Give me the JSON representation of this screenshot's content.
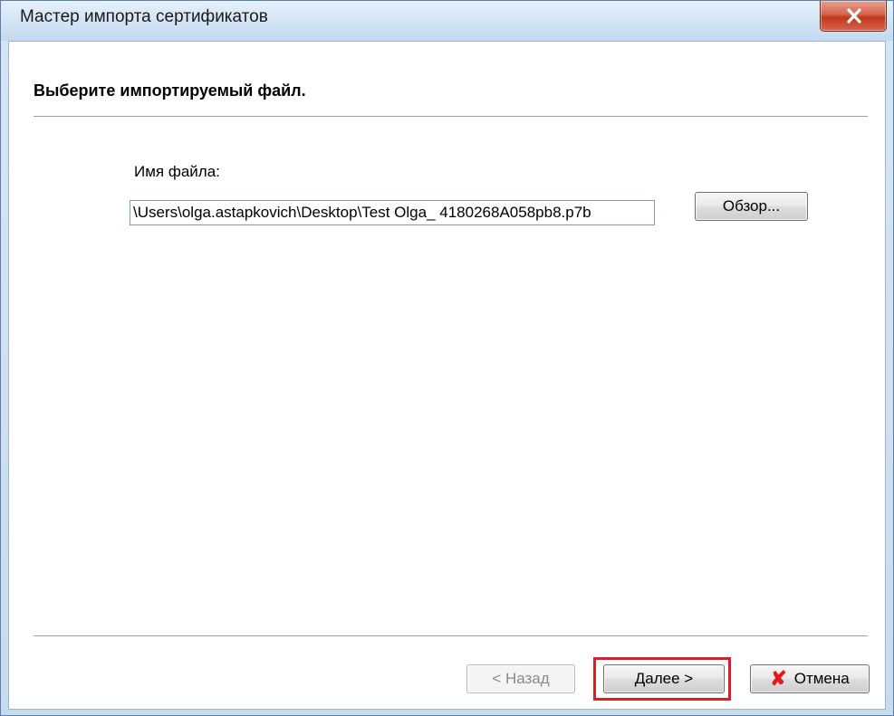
{
  "window": {
    "title": "Мастер импорта сертификатов"
  },
  "page": {
    "heading": "Выберите импортируемый файл."
  },
  "file": {
    "label": "Имя файла:",
    "value": "\\Users\\olga.astapkovich\\Desktop\\Test Olga_ 4180268A058pb8.p7b"
  },
  "buttons": {
    "browse": "Обзор...",
    "back": "< Назад",
    "next": "Далее >",
    "cancel": "Отмена"
  },
  "icons": {
    "close": "close-icon",
    "cancel": "red-x-icon"
  },
  "colors": {
    "highlight": "#d6212b",
    "close_button": "#c0391d"
  }
}
